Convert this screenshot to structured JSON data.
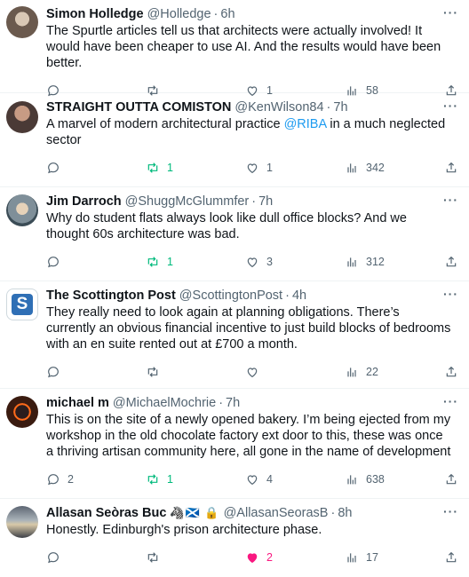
{
  "tweets": [
    {
      "name": "Simon Holledge",
      "handle": "@Holledge",
      "time": "6h",
      "badges": "",
      "text": "The Spurtle articles tell us that architects were actually involved! It would have been cheaper to use AI. And the results would have been better.",
      "mention": "",
      "text_after": "",
      "replies": "",
      "retweets": "",
      "likes": "1",
      "views": "58",
      "retweeted": false,
      "liked": false
    },
    {
      "name": "STRAIGHT OUTTA COMISTON",
      "handle": "@KenWilson84",
      "time": "7h",
      "badges": "",
      "text": "A marvel of modern architectural practice ",
      "mention": "@RIBA",
      "text_after": " in a much neglected sector",
      "replies": "",
      "retweets": "1",
      "likes": "1",
      "views": "342",
      "retweeted": true,
      "liked": false
    },
    {
      "name": "Jim Darroch",
      "handle": "@ShuggMcGlummfer",
      "time": "7h",
      "badges": "",
      "text": "Why do student flats always look like dull office  blocks? And we thought 60s architecture was bad.",
      "mention": "",
      "text_after": "",
      "replies": "",
      "retweets": "1",
      "likes": "3",
      "views": "312",
      "retweeted": true,
      "liked": false
    },
    {
      "name": "The Scottington Post",
      "handle": "@ScottingtonPost",
      "time": "4h",
      "badges": "",
      "text": "They really need to look again at planning obligations. There’s currently an obvious financial incentive to just build blocks of bedrooms with an en suite rented out at £700 a month.",
      "mention": "",
      "text_after": "",
      "replies": "",
      "retweets": "",
      "likes": "",
      "views": "22",
      "retweeted": false,
      "liked": false
    },
    {
      "name": "michael m",
      "handle": "@MichaelMochrie",
      "time": "7h",
      "badges": "",
      "text": "This is on the site of a newly opened bakery. I’m being ejected from my workshop in the old chocolate factory ext door to this, these was once a thriving artisan community here, all gone in the name of development",
      "mention": "",
      "text_after": "",
      "replies": "2",
      "retweets": "1",
      "likes": "4",
      "views": "638",
      "retweeted": true,
      "liked": false
    },
    {
      "name": "Allasan Seòras Buc",
      "handle": "@AllasanSeorasB",
      "time": "8h",
      "badges": "🦓🏴󠁧󠁢󠁳󠁣󠁴󠁿 🔒",
      "text": "Honestly. Edinburgh's prison architecture phase.",
      "mention": "",
      "text_after": "",
      "replies": "",
      "retweets": "",
      "likes": "2",
      "views": "17",
      "retweeted": false,
      "liked": true
    }
  ],
  "ui": {
    "dot": "·",
    "more": "···",
    "avatar3_letter": "S"
  },
  "colors": {
    "muted": "#536471",
    "link": "#1d9bf0",
    "retweet": "#00ba7c",
    "like": "#f91880"
  },
  "icons": [
    "reply-icon",
    "retweet-icon",
    "like-icon",
    "views-icon",
    "share-icon",
    "more-icon"
  ]
}
